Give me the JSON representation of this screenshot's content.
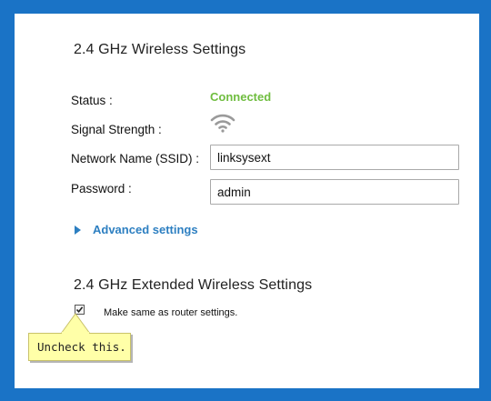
{
  "wireless_24": {
    "title": "2.4 GHz Wireless Settings",
    "status_label": "Status :",
    "status_value": "Connected",
    "signal_label": "Signal Strength :",
    "signal_icon": "wifi-signal-icon",
    "ssid_label": "Network Name (SSID) :",
    "ssid_value": "linksysext",
    "password_label": "Password :",
    "password_value": "admin",
    "advanced_label": "Advanced settings"
  },
  "extended_24": {
    "title": "2.4 GHz Extended Wireless Settings",
    "same_as_router_label": "Make same as router settings.",
    "same_as_router_checked": true
  },
  "callout": {
    "text": "Uncheck this."
  },
  "colors": {
    "background": "#1a73c6",
    "connected": "#6fbd3f",
    "link": "#2d7fc1",
    "callout": "#ffffa8"
  }
}
